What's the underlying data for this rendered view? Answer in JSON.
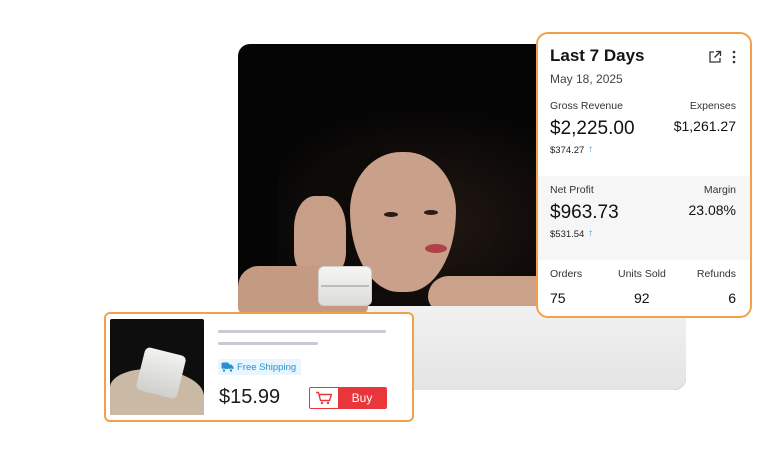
{
  "stats_card": {
    "title": "Last 7 Days",
    "date": "May 18, 2025",
    "icons": [
      "external-link-icon",
      "more-vertical-icon"
    ],
    "gross_revenue": {
      "label": "Gross Revenue",
      "value": "$2,225.00",
      "change": "$374.27",
      "trend": "up"
    },
    "expenses": {
      "label": "Expenses",
      "value": "$1,261.27"
    },
    "net_profit": {
      "label": "Net Profit",
      "value": "$963.73",
      "change": "$531.54",
      "trend": "up"
    },
    "margin": {
      "label": "Margin",
      "value": "23.08%"
    },
    "orders": {
      "label": "Orders",
      "value": "75"
    },
    "units_sold": {
      "label": "Units Sold",
      "value": "92"
    },
    "refunds": {
      "label": "Refunds",
      "value": "6"
    },
    "accent_color": "#f0a24a",
    "trend_color": "#3a9ad9"
  },
  "product_card": {
    "shipping_badge": "Free Shipping",
    "price": "$15.99",
    "buy_label": "Buy",
    "buy_color": "#e8363a",
    "icons": [
      "truck-icon",
      "cart-icon"
    ]
  },
  "symbols": {
    "up_arrow": "↑"
  }
}
